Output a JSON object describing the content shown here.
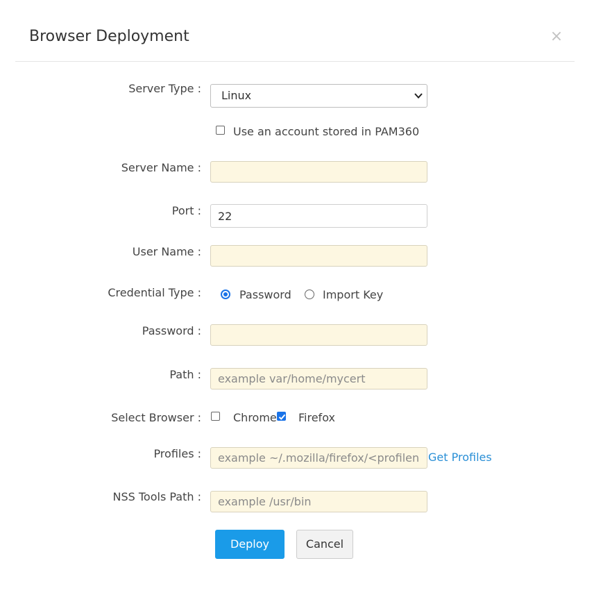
{
  "dialog": {
    "title": "Browser Deployment",
    "close_symbol": "×"
  },
  "form": {
    "server_type": {
      "label": "Server Type :",
      "selected": "Linux"
    },
    "use_stored_account": {
      "label": "Use an account stored in PAM360",
      "checked": false
    },
    "server_name": {
      "label": "Server Name :",
      "value": "",
      "placeholder": ""
    },
    "port": {
      "label": "Port :",
      "value": "22"
    },
    "user_name": {
      "label": "User Name :",
      "value": "",
      "placeholder": ""
    },
    "credential_type": {
      "label": "Credential Type :",
      "options": [
        {
          "label": "Password",
          "checked": true
        },
        {
          "label": "Import Key",
          "checked": false
        }
      ]
    },
    "password": {
      "label": "Password :",
      "value": ""
    },
    "path": {
      "label": "Path :",
      "placeholder": "example var/home/mycert"
    },
    "select_browser": {
      "label": "Select Browser :",
      "options": [
        {
          "label": "Chrome",
          "checked": false
        },
        {
          "label": "Firefox",
          "checked": true
        }
      ]
    },
    "profiles": {
      "label": "Profiles :",
      "placeholder": "example ~/.mozilla/firefox/<profilename>",
      "link_label": "Get Profiles"
    },
    "nss_tools_path": {
      "label": "NSS Tools Path :",
      "placeholder": "example /usr/bin"
    }
  },
  "actions": {
    "deploy_label": "Deploy",
    "cancel_label": "Cancel"
  },
  "colors": {
    "primary": "#1a9be8",
    "link": "#2a8fd6",
    "field_highlight": "#fdf7e1",
    "check_accent": "#1a73e8"
  }
}
